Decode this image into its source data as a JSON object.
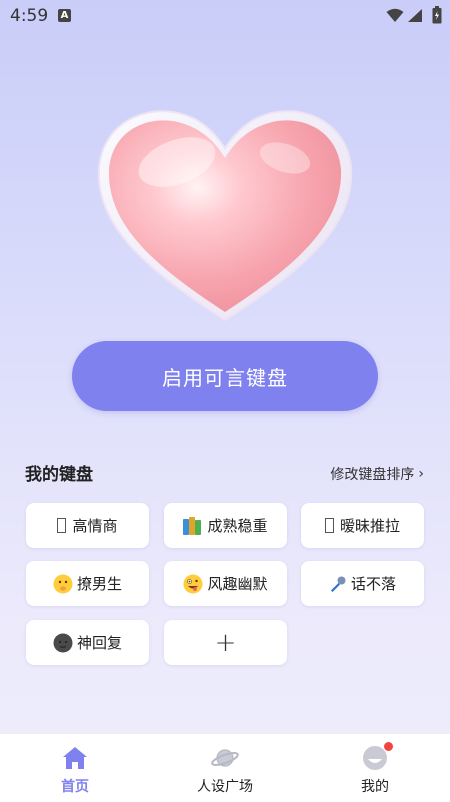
{
  "status_bar": {
    "time": "4:59",
    "notification_icon": "A",
    "icons": [
      "wifi-icon",
      "signal-icon",
      "battery-icon"
    ]
  },
  "hero": {
    "image": "pink-heart"
  },
  "enable_button": {
    "label": "启用可言键盘"
  },
  "section": {
    "title": "我的键盘",
    "sort_link": "修改键盘排序",
    "sort_chevron": "›"
  },
  "keyboards": [
    {
      "label": "高情商",
      "icon": "missing-glyph-icon"
    },
    {
      "label": "成熟稳重",
      "icon": "books-icon"
    },
    {
      "label": "暧昧推拉",
      "icon": "missing-glyph-icon"
    },
    {
      "label": "撩男生",
      "icon": "shushing-face-icon"
    },
    {
      "label": "风趣幽默",
      "icon": "zany-face-icon"
    },
    {
      "label": "话不落",
      "icon": "microphone-icon"
    },
    {
      "label": "神回复",
      "icon": "dark-face-icon"
    }
  ],
  "add_button": {
    "label": "+"
  },
  "tabs": [
    {
      "label": "首页",
      "icon": "home-icon",
      "active": true
    },
    {
      "label": "人设广场",
      "icon": "planet-icon",
      "active": false
    },
    {
      "label": "我的",
      "icon": "avatar-icon",
      "active": false,
      "badge": true
    }
  ],
  "colors": {
    "accent": "#7f82ee",
    "background_top": "#c9cdf8",
    "background_bottom": "#efeefc",
    "badge": "#f2453d"
  }
}
